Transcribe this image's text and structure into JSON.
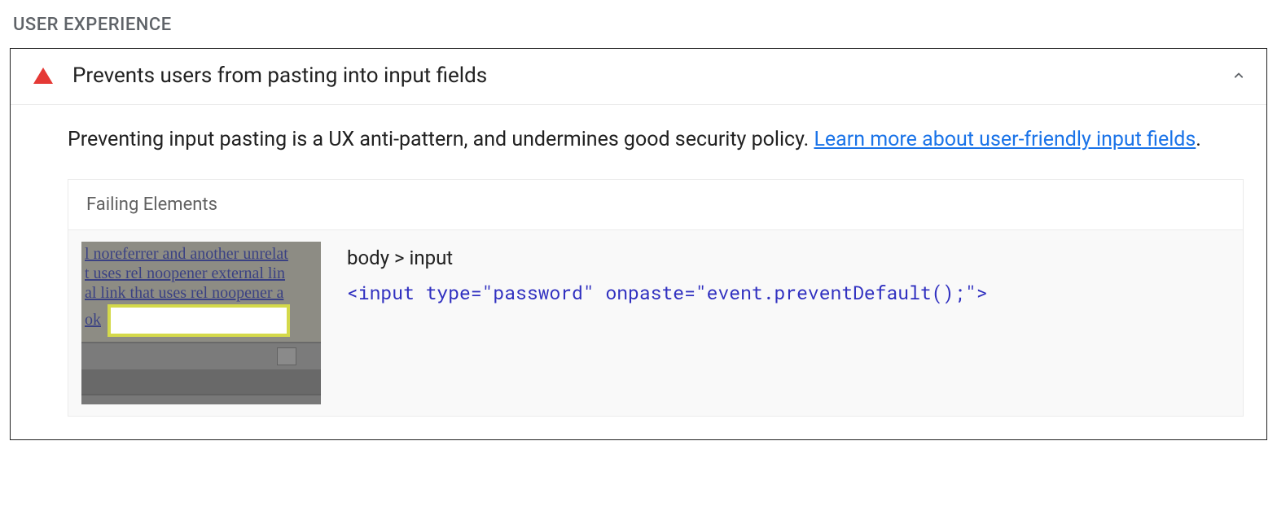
{
  "section": {
    "heading": "USER EXPERIENCE"
  },
  "audit": {
    "title": "Prevents users from pasting into input fields",
    "description_text": "Preventing input pasting is a UX anti-pattern, and undermines good security policy. ",
    "link_text": "Learn more about user-friendly input fields",
    "description_suffix": "."
  },
  "failing": {
    "header": "Failing Elements",
    "selector": "body > input",
    "snippet": "<input type=\"password\" onpaste=\"event.preventDefault();\">"
  },
  "thumb": {
    "line1": "l noreferrer and another unrelat",
    "line2": "t uses rel noopener external lin",
    "line3": "al link that uses rel noopener a",
    "ok": "ok"
  },
  "icons": {
    "warning": "warning-triangle-icon",
    "chevron": "chevron-up-icon"
  }
}
